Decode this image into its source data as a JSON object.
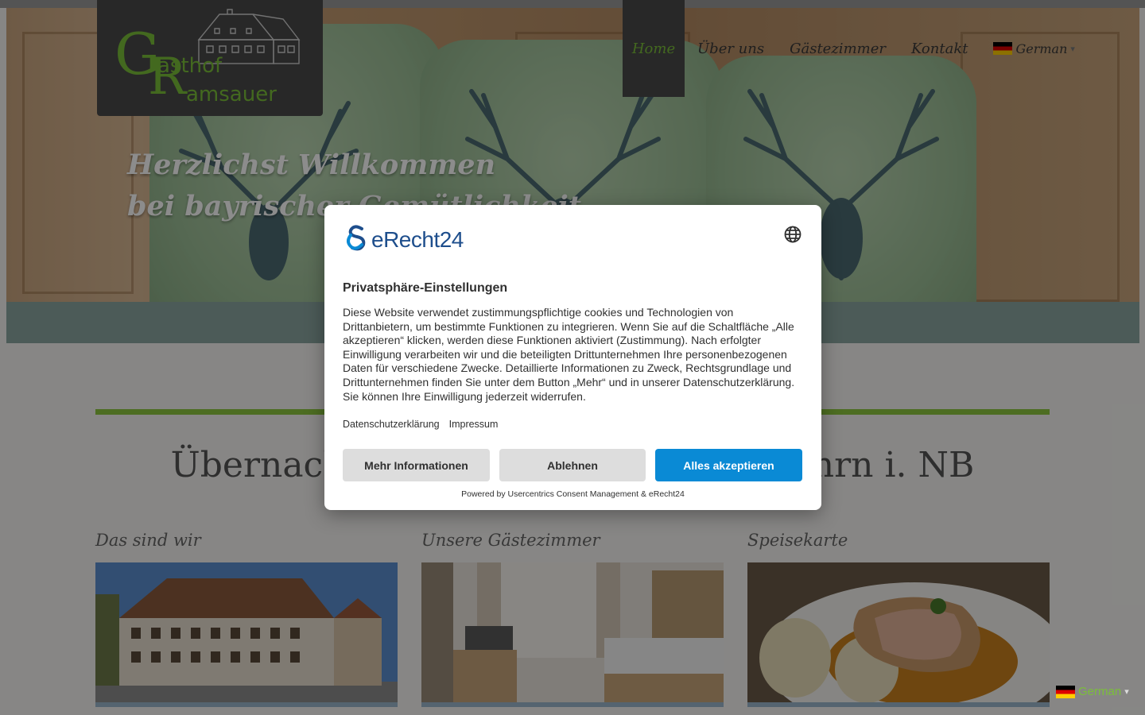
{
  "logo": {
    "letter_g": "G",
    "letter_r": "R",
    "text_top": "asthof",
    "text_bottom": "amsauer"
  },
  "nav": {
    "items": [
      {
        "label": "Home",
        "active": true
      },
      {
        "label": "Über uns",
        "active": false
      },
      {
        "label": "Gästezimmer",
        "active": false
      },
      {
        "label": "Kontakt",
        "active": false
      }
    ],
    "language": "German",
    "caret": "▾"
  },
  "hero": {
    "line1": "Herzlichst Willkommen",
    "line2": "bei bayrischer Gemütlichkeit"
  },
  "main": {
    "heading": "Übernachten und Genießen in Parsberg i. d. Opf. — Rastbahn i. NB",
    "heading_visible_left": "Übernach",
    "heading_visible_right": "ahrn i. NB",
    "columns": [
      {
        "title": "Das sind wir"
      },
      {
        "title": "Unsere Gästezimmer"
      },
      {
        "title": "Speisekarte"
      }
    ]
  },
  "consent": {
    "brand": "eRecht24",
    "title": "Privatsphäre-Einstellungen",
    "body": "Diese Website verwendet zustimmungspflichtige cookies und Technologien von Drittanbietern, um bestimmte Funktionen zu integrieren. Wenn Sie auf die Schaltfläche „Alle akzeptieren“ klicken, werden diese Funktionen aktiviert (Zustimmung). Nach erfolgter Einwilligung verarbeiten wir und die beteiligten Drittunternehmen Ihre personenbezogenen Daten für verschiedene Zwecke. Detaillierte Informationen zu Zweck, Rechtsgrundlage und Drittunternehmen finden Sie unter dem Button „Mehr“ und in unserer Datenschutzerklärung. Sie können Ihre Einwilligung jederzeit widerrufen.",
    "links": [
      "Datenschutzerklärung",
      "Impressum"
    ],
    "buttons": {
      "more": "Mehr Informationen",
      "decline": "Ablehnen",
      "accept": "Alles akzeptieren"
    },
    "powered_by": "Powered by Usercentrics Consent Management & eRecht24"
  },
  "lang_widget": {
    "label": "German",
    "caret": "▾"
  },
  "colors": {
    "accent_green": "#7bbf3a",
    "bar_green": "#8cc63f",
    "accept_blue": "#0a8ad5",
    "brand_blue": "#1e4e8c",
    "dark_box": "#4a4a4a"
  }
}
